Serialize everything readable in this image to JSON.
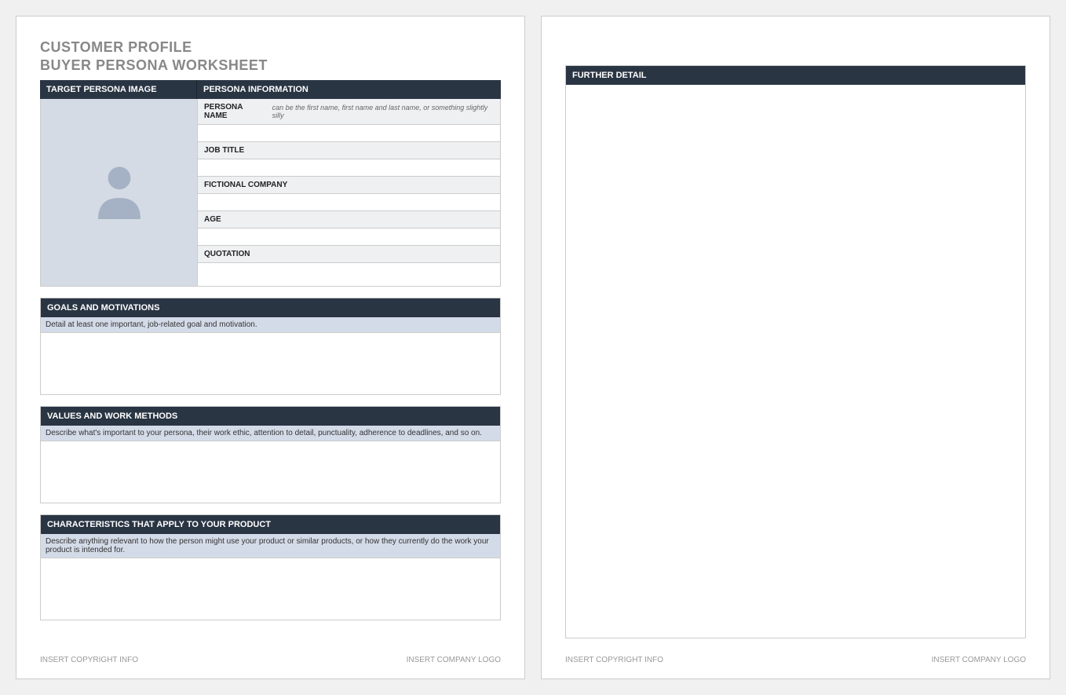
{
  "title_line1": "CUSTOMER PROFILE",
  "title_line2": "BUYER PERSONA WORKSHEET",
  "headers": {
    "image": "TARGET PERSONA IMAGE",
    "info": "PERSONA INFORMATION"
  },
  "fields": {
    "persona_name": {
      "label": "PERSONA NAME",
      "hint": "can be the first name, first name and last name, or something slightly silly"
    },
    "job_title": {
      "label": "JOB TITLE"
    },
    "fictional_company": {
      "label": "FICTIONAL COMPANY"
    },
    "age": {
      "label": "AGE"
    },
    "quotation": {
      "label": "QUOTATION"
    }
  },
  "sections": {
    "goals": {
      "header": "GOALS AND MOTIVATIONS",
      "prompt": "Detail at least one important, job-related goal and motivation."
    },
    "values": {
      "header": "VALUES AND WORK METHODS",
      "prompt": "Describe what's important to your persona, their work ethic, attention to detail, punctuality, adherence to deadlines, and so on."
    },
    "characteristics": {
      "header": "CHARACTERISTICS THAT APPLY TO YOUR PRODUCT",
      "prompt": "Describe anything relevant to how the person might use your product or similar products, or how they currently do the work your product is intended for."
    },
    "further_detail": {
      "header": "FURTHER DETAIL"
    }
  },
  "footer": {
    "copyright": "INSERT COPYRIGHT INFO",
    "logo": "INSERT COMPANY LOGO"
  }
}
